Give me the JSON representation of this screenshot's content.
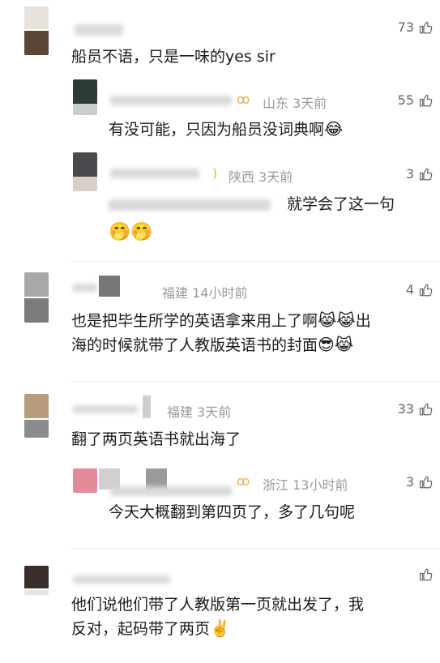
{
  "comments": [
    {
      "id": "c1",
      "likes": "73",
      "body": "船员不语，只是一味的yes sir",
      "replies": [
        {
          "id": "r1",
          "location_time": "山东 3天前",
          "likes": "55",
          "body": "有没可能，只因为船员没词典啊",
          "emoji": "😂"
        },
        {
          "id": "r2",
          "location_time": "陕西 3天前",
          "likes": "3",
          "body": "就学会了这一句",
          "emoji": "🤭🤭"
        }
      ]
    },
    {
      "id": "c2",
      "location_time": "福建 14小时前",
      "likes": "4",
      "body_line1": "也是把毕生所学的英语拿来用上了啊",
      "emoji_line1": "😹😹",
      "tail_line1": "出",
      "body_line2": "海的时候就带了人教版英语书的封面",
      "emoji_line2": "😎😹"
    },
    {
      "id": "c3",
      "location_time": "福建 3天前",
      "likes": "33",
      "body": "翻了两页英语书就出海了",
      "replies": [
        {
          "id": "r3",
          "location_time": "浙江 13小时前",
          "likes": "3",
          "body": "今天大概翻到第四页了，多了几句呢"
        }
      ]
    },
    {
      "id": "c4",
      "body_line1": "他们说他们带了人教版第一页就出发了，我",
      "body_line2": "反对，起码带了两页",
      "emoji_line2": "✌️"
    }
  ],
  "colors": {
    "meta_text": "#9a9a9a",
    "body_text": "#1a1a1a",
    "like_icon": "#666666",
    "divider": "#eeeeee"
  },
  "icons": {
    "like": "thumbs-up-icon",
    "vip_badge": "vip-badge-icon"
  }
}
